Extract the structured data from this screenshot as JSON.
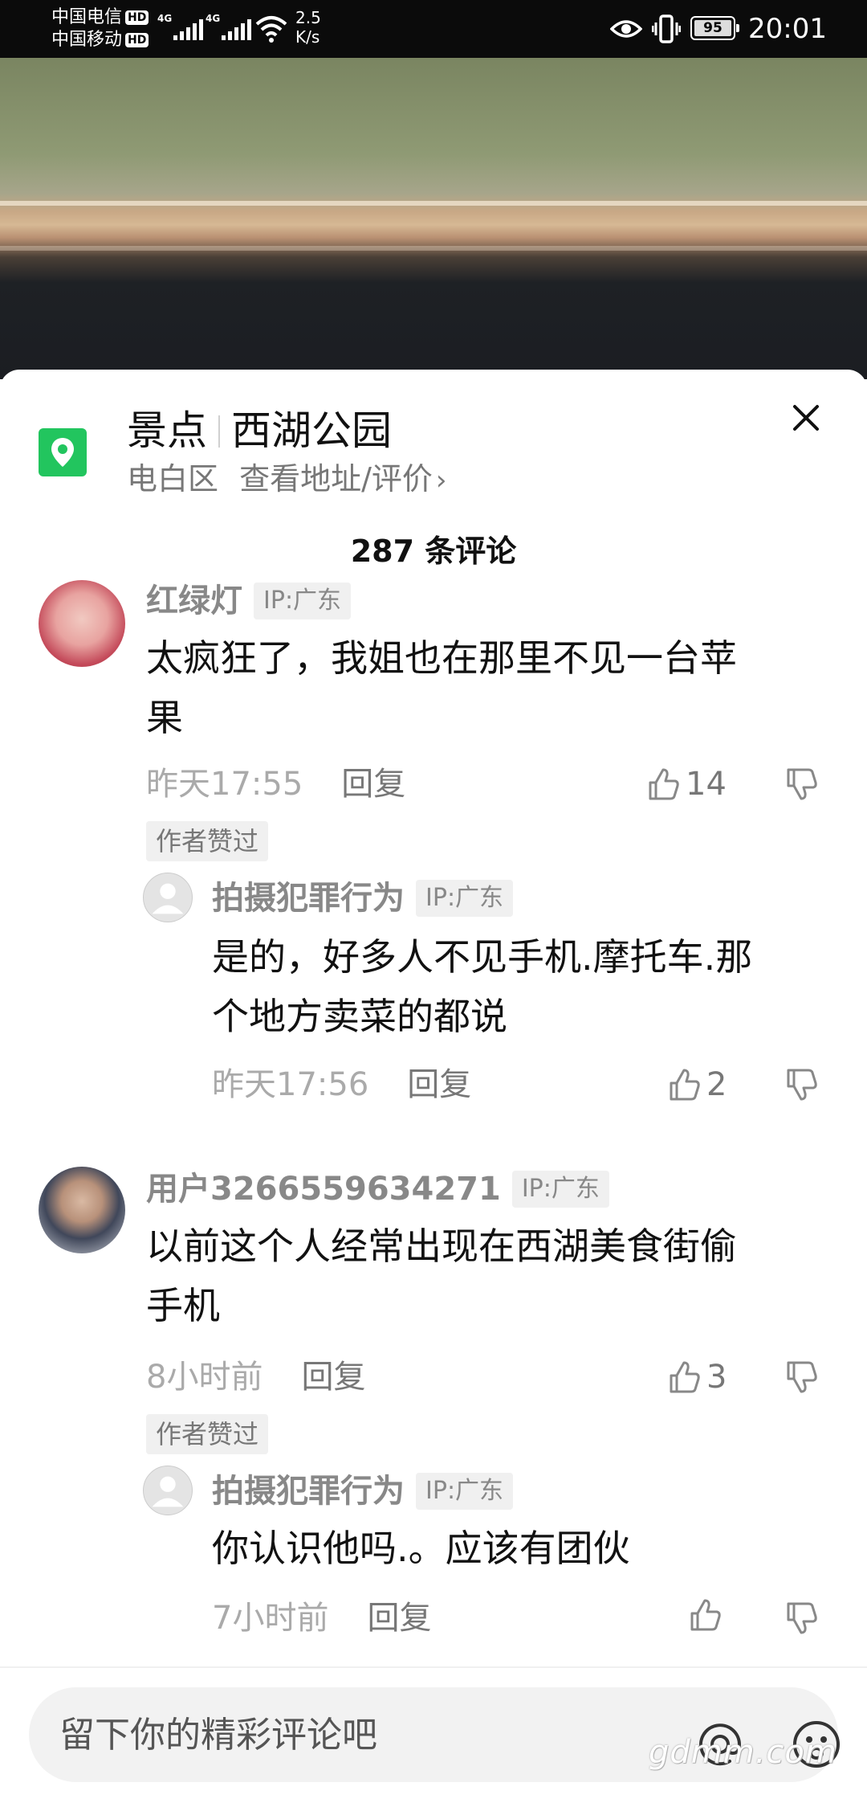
{
  "status_bar": {
    "carrier1": "中国电信",
    "carrier2": "中国移动",
    "hd": "HD",
    "net1": "4G",
    "net2": "4G",
    "speed_value": "2.5",
    "speed_unit": "K/s",
    "battery": "95",
    "time": "20:01"
  },
  "location": {
    "category": "景点",
    "name": "西湖公园",
    "district": "电白区",
    "link": "查看地址/评价",
    "chevron": "›",
    "accent_color": "#22c55e"
  },
  "comments_header": {
    "count": "287 条评论"
  },
  "comments": [
    {
      "user": "红绿灯",
      "ip": "IP:广东",
      "text_line1": "太疯狂了，我姐也在那里不见一台苹",
      "text_line2": "果",
      "time": "昨天17:55",
      "reply": "回复",
      "likes": "14",
      "badge": "作者赞过",
      "sub": {
        "user": "拍摄犯罪行为",
        "ip": "IP:广东",
        "text_line1": "是的，好多人不见手机.摩托车.那",
        "text_line2": "个地方卖菜的都说",
        "time": "昨天17:56",
        "reply": "回复",
        "likes": "2"
      }
    },
    {
      "user": "用户3266559634271",
      "ip": "IP:广东",
      "text_line1": "以前这个人经常出现在西湖美食街偷",
      "text_line2": "手机",
      "time": "8小时前",
      "reply": "回复",
      "likes": "3",
      "badge": "作者赞过",
      "sub": {
        "user": "拍摄犯罪行为",
        "ip": "IP:广东",
        "text_line1": "你认识他吗.。应该有团伙",
        "time": "7小时前",
        "reply": "回复",
        "likes": ""
      }
    }
  ],
  "input": {
    "placeholder": "留下你的精彩评论吧"
  },
  "watermark": "gdmm.com"
}
